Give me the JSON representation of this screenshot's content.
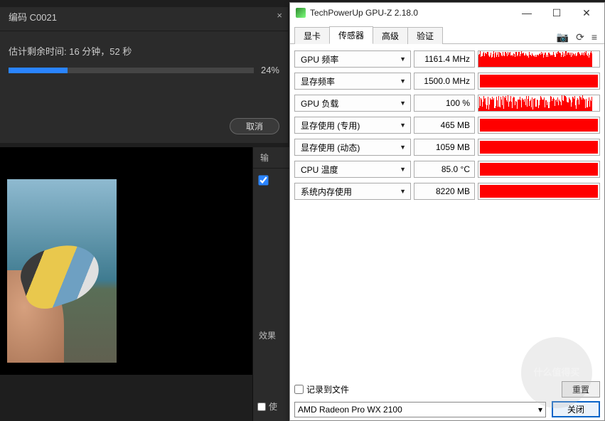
{
  "encode": {
    "title": "编码 C0021",
    "close": "×",
    "timeLabel": "估计剩余时间: 16 分钟，52 秒",
    "percent": "24%",
    "progressWidth": "24%",
    "cancel": "取消"
  },
  "sidePanel": {
    "label1": "输",
    "label2": "效果",
    "label3": "使"
  },
  "gpuz": {
    "title": "TechPowerUp GPU-Z 2.18.0",
    "sysMin": "—",
    "sysMax": "☐",
    "sysClose": "✕",
    "tabs": {
      "t1": "显卡",
      "t2": "传感器",
      "t3": "高级",
      "t4": "验证"
    },
    "tools": {
      "cam": "📷",
      "refresh": "⟳",
      "menu": "≡"
    },
    "sensors": [
      {
        "label": "GPU 频率",
        "value": "1161.4 MHz",
        "style": "noise-high"
      },
      {
        "label": "显存频率",
        "value": "1500.0 MHz",
        "style": "full"
      },
      {
        "label": "GPU 负载",
        "value": "100 %",
        "style": "noise-var"
      },
      {
        "label": "显存使用 (专用)",
        "value": "465 MB",
        "style": "full"
      },
      {
        "label": "显存使用 (动态)",
        "value": "1059 MB",
        "style": "full"
      },
      {
        "label": "CPU 温度",
        "value": "85.0 °C",
        "style": "full"
      },
      {
        "label": "系统内存使用",
        "value": "8220 MB",
        "style": "full"
      }
    ],
    "logToFile": "记录到文件",
    "reset": "重置",
    "gpuSelect": "AMD Radeon Pro WX 2100",
    "closeBtn": "关闭"
  },
  "watermark": "什么值得买"
}
